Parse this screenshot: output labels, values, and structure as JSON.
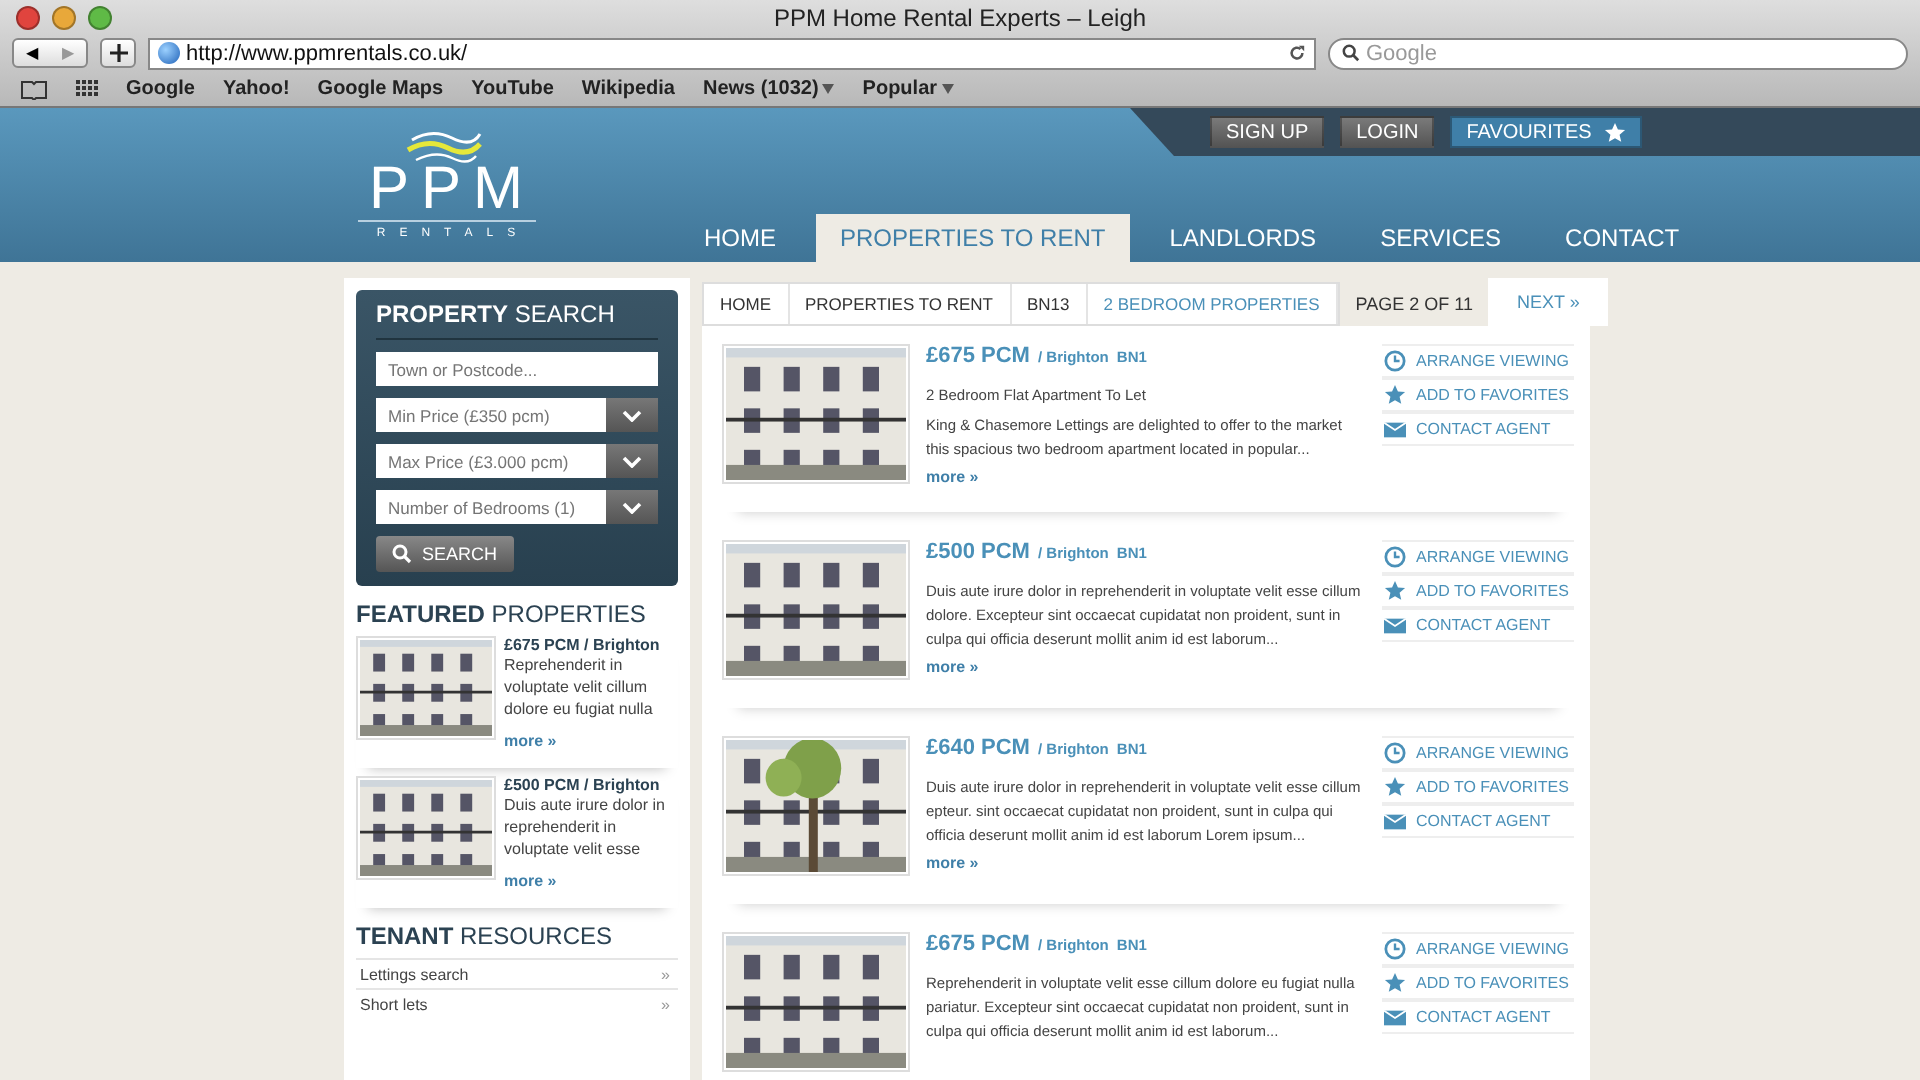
{
  "window": {
    "title": "PPM Home Rental Experts – Leigh"
  },
  "toolbar": {
    "back": "◀",
    "forward": "▶",
    "url": "http://www.ppmrentals.co.uk/",
    "search_placeholder": "Google"
  },
  "bookmarks": [
    {
      "label": "Google",
      "menu": false
    },
    {
      "label": "Yahoo!",
      "menu": false
    },
    {
      "label": "Google Maps",
      "menu": false
    },
    {
      "label": "YouTube",
      "menu": false
    },
    {
      "label": "Wikipedia",
      "menu": false
    },
    {
      "label": "News (1032)",
      "menu": true
    },
    {
      "label": "Popular",
      "menu": true
    }
  ],
  "header": {
    "logo": "PPM",
    "logo_sub": "RENTALS",
    "account_buttons": [
      {
        "label": "SIGN UP",
        "kind": "plain"
      },
      {
        "label": "LOGIN",
        "kind": "plain"
      },
      {
        "label": "FAVOURITES",
        "kind": "star"
      }
    ],
    "nav": [
      {
        "label": "HOME",
        "selected": false
      },
      {
        "label": "PROPERTIES TO RENT",
        "selected": true
      },
      {
        "label": "LANDLORDS",
        "selected": false
      },
      {
        "label": "SERVICES",
        "selected": false
      },
      {
        "label": "CONTACT",
        "selected": false
      }
    ]
  },
  "search": {
    "title": "**PROPERTY** SEARCH",
    "town_placeholder": "Town or Postcode...",
    "selects": [
      {
        "placeholder": "Min Price (£350 pcm)"
      },
      {
        "placeholder": "Max Price (£3.000 pcm)"
      },
      {
        "placeholder": "Number of Bedrooms (1)"
      }
    ],
    "button": "SEARCH"
  },
  "featured": {
    "title": "**FEATURED** PROPERTIES",
    "items": [
      {
        "price": "£675 PCM / Brighton",
        "text": "Reprehenderit in voluptate velit cillum dolore eu fugiat nulla",
        "more": "more »"
      },
      {
        "price": "£500 PCM / Brighton",
        "text": "Duis aute irure dolor in reprehenderit in voluptate velit esse",
        "more": "more »"
      }
    ]
  },
  "resources": {
    "title": "**TENANT** RESOURCES",
    "items": [
      {
        "label": "Lettings search",
        "arrow": "»"
      },
      {
        "label": "Short lets",
        "arrow": "»"
      }
    ]
  },
  "breadcrumb": [
    {
      "label": "HOME",
      "selected": false
    },
    {
      "label": "PROPERTIES TO RENT",
      "selected": false
    },
    {
      "label": "BN13",
      "selected": false
    },
    {
      "label": "2 BEDROOM PROPERTIES",
      "selected": true
    }
  ],
  "pager": {
    "page": "PAGE 2 OF 11",
    "next": "NEXT »"
  },
  "listings": [
    {
      "price": "£675 PCM",
      "location": "/ Brighton",
      "postcode": "BN1",
      "subtitle": "2 Bedroom Flat Apartment To Let",
      "text": "King & Chasemore Lettings are delighted to offer to the market this spacious two bedroom apartment located in popular...",
      "more": "more »",
      "actions": [
        "ARRANGE VIEWING",
        "ADD TO FAVORITES",
        "CONTACT AGENT"
      ]
    },
    {
      "price": "£500 PCM",
      "location": "/ Brighton",
      "postcode": "BN1",
      "text": "Duis aute irure dolor in reprehenderit in voluptate velit esse cillum dolore. Excepteur sint occaecat cupidatat non proident, sunt in culpa qui officia deserunt mollit anim id est laborum...",
      "more": "more »",
      "actions": [
        "ARRANGE VIEWING",
        "ADD TO FAVORITES",
        "CONTACT AGENT"
      ]
    },
    {
      "price": "£640 PCM",
      "location": "/ Brighton",
      "postcode": "BN1",
      "text": "Duis aute irure dolor in reprehenderit in voluptate velit esse cillum epteur. sint occaecat cupidatat non proident, sunt in culpa qui officia deserunt mollit anim id est laborum Lorem ipsum...",
      "more": "more »",
      "actions": [
        "ARRANGE VIEWING",
        "ADD TO FAVORITES",
        "CONTACT AGENT"
      ]
    },
    {
      "price": "£675 PCM",
      "location": "/ Brighton",
      "postcode": "BN1",
      "text": "Reprehenderit in voluptate velit esse cillum dolore eu fugiat nulla pariatur. Excepteur sint occaecat cupidatat non proident, sunt in culpa qui officia deserunt mollit anim id est laborum...",
      "actions": [
        "ARRANGE VIEWING",
        "ADD TO FAVORITES",
        "CONTACT AGENT"
      ]
    }
  ]
}
